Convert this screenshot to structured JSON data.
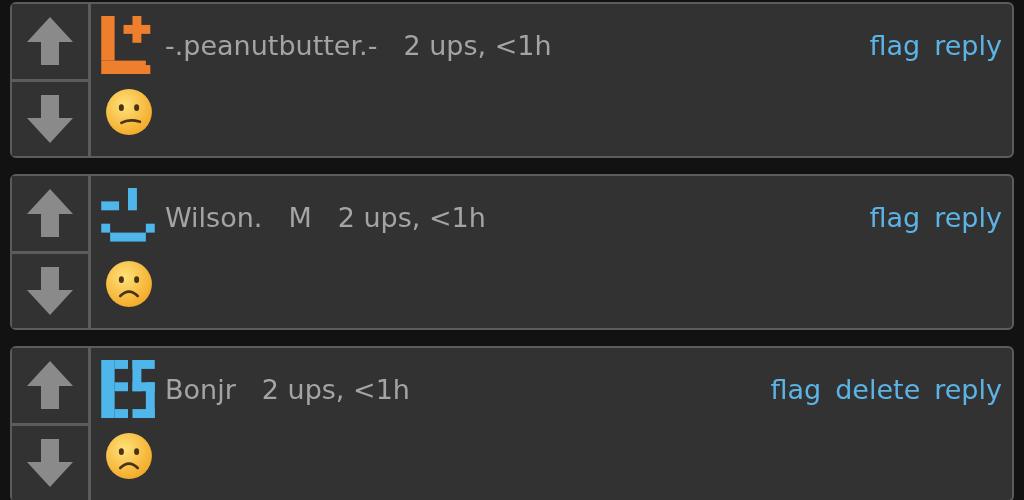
{
  "comments": [
    {
      "avatar": {
        "color": "#ee7f2d"
      },
      "username": "-.peanutbutter.-",
      "meta": "2 ups, <1h",
      "actions": [
        "flag",
        "reply"
      ],
      "emoji": {
        "kind": "confused"
      }
    },
    {
      "avatar": {
        "color": "#4fb6ec"
      },
      "username": "Wilson.",
      "badge": "M",
      "meta": "2 ups, <1h",
      "actions": [
        "flag",
        "reply"
      ],
      "emoji": {
        "kind": "frowning"
      }
    },
    {
      "avatar": {
        "color": "#4fb6ec"
      },
      "username": "Bonjr",
      "meta": "2 ups, <1h",
      "actions": [
        "flag",
        "delete",
        "reply"
      ],
      "emoji": {
        "kind": "frowning"
      }
    }
  ]
}
